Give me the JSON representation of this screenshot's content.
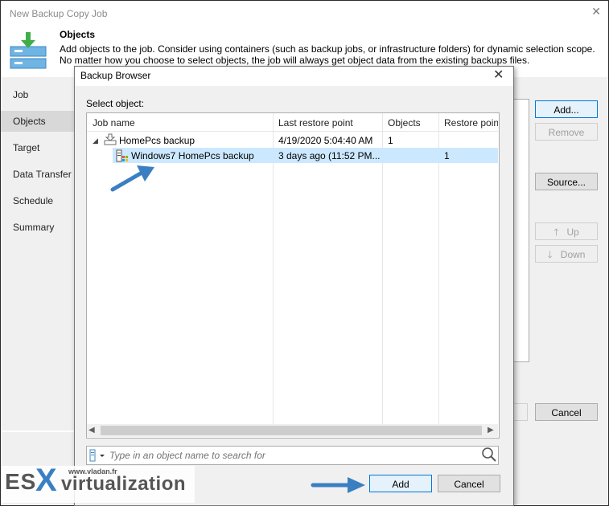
{
  "wizard": {
    "title": "New Backup Copy Job",
    "step_title": "Objects",
    "step_description": "Add objects to the job. Consider using containers (such as backup jobs, or infrastructure folders) for dynamic selection scope. No matter how you choose to select objects, the job will always get object data from the existing backups files.",
    "nav": [
      "Job",
      "Objects",
      "Target",
      "Data Transfer",
      "Schedule",
      "Summary"
    ],
    "selected_nav": "Objects",
    "buttons": {
      "add": "Add...",
      "remove": "Remove",
      "source": "Source...",
      "up": "Up",
      "down": "Down",
      "cancel": "Cancel"
    }
  },
  "dialog": {
    "title": "Backup Browser",
    "select_label": "Select object:",
    "columns": [
      "Job name",
      "Last restore point",
      "Objects",
      "Restore poin"
    ],
    "rows": [
      {
        "name": "HomePcs backup",
        "last_restore": "4/19/2020 5:04:40 AM",
        "objects": "1",
        "restore_points": ""
      },
      {
        "name": "Windows7 HomePcs backup",
        "last_restore": "3 days ago (11:52 PM...",
        "objects": "",
        "restore_points": "1"
      }
    ],
    "search_placeholder": "Type in an object name to search for",
    "add_button": "Add",
    "cancel_button": "Cancel"
  },
  "watermark": {
    "brand_es": "ES",
    "brand_x": "X",
    "brand_rest": "virtualization",
    "site": "www.vladan.fr"
  },
  "colors": {
    "selection": "#cce8ff",
    "arrow": "#3a7fc1",
    "watermark_text": "#555555"
  }
}
